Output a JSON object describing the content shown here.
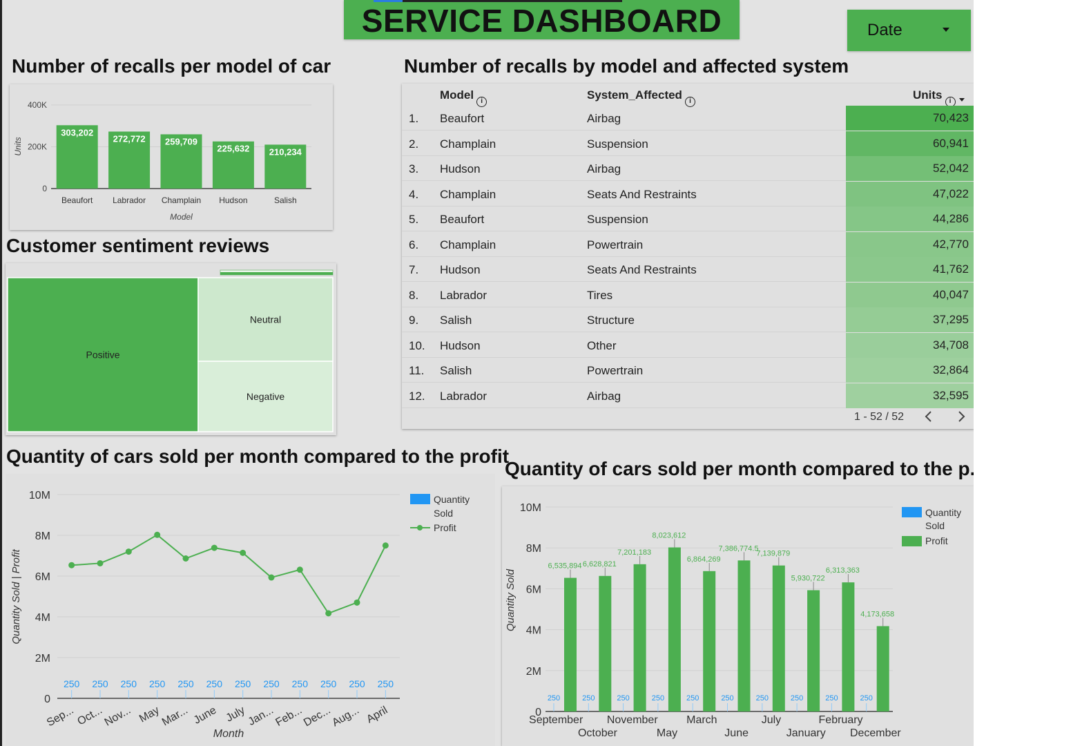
{
  "header": {
    "title": "SERVICE DASHBOARD",
    "date_filter_label": "Date"
  },
  "recalls_per_model": {
    "section_title": "Number of recalls per model of car",
    "chart_data": {
      "type": "bar",
      "categories": [
        "Beaufort",
        "Labrador",
        "Champlain",
        "Hudson",
        "Salish"
      ],
      "values": [
        303202,
        272772,
        259709,
        225632,
        210234
      ],
      "value_labels": [
        "303,202",
        "272,772",
        "259,709",
        "225,632",
        "210,234"
      ],
      "yticks": [
        "400K",
        "200K",
        "0"
      ],
      "ylim": [
        0,
        400000
      ],
      "xlabel": "Model",
      "ylabel": "Units",
      "color": "#4caf50"
    }
  },
  "sentiment": {
    "section_title": "Customer sentiment reviews",
    "chart_data": {
      "type": "treemap",
      "labels": [
        "Positive",
        "Neutral",
        "Negative"
      ],
      "colors": [
        "#4caf50",
        "#cde8cd",
        "#d9eed9"
      ]
    }
  },
  "recalls_table": {
    "section_title": "Number of recalls by model and affected system",
    "columns": [
      "Model",
      "System_Affected",
      "Units"
    ],
    "rows": [
      {
        "idx": "1.",
        "model": "Beaufort",
        "system": "Airbag",
        "units": "70,423",
        "value": 70423
      },
      {
        "idx": "2.",
        "model": "Champlain",
        "system": "Suspension",
        "units": "60,941",
        "value": 60941
      },
      {
        "idx": "3.",
        "model": "Hudson",
        "system": "Airbag",
        "units": "52,042",
        "value": 52042
      },
      {
        "idx": "4.",
        "model": "Champlain",
        "system": "Seats And Restraints",
        "units": "47,022",
        "value": 47022
      },
      {
        "idx": "5.",
        "model": "Beaufort",
        "system": "Suspension",
        "units": "44,286",
        "value": 44286
      },
      {
        "idx": "6.",
        "model": "Champlain",
        "system": "Powertrain",
        "units": "42,770",
        "value": 42770
      },
      {
        "idx": "7.",
        "model": "Hudson",
        "system": "Seats And Restraints",
        "units": "41,762",
        "value": 41762
      },
      {
        "idx": "8.",
        "model": "Labrador",
        "system": "Tires",
        "units": "40,047",
        "value": 40047
      },
      {
        "idx": "9.",
        "model": "Salish",
        "system": "Structure",
        "units": "37,295",
        "value": 37295
      },
      {
        "idx": "10.",
        "model": "Hudson",
        "system": "Other",
        "units": "34,708",
        "value": 34708
      },
      {
        "idx": "11.",
        "model": "Salish",
        "system": "Powertrain",
        "units": "32,864",
        "value": 32864
      },
      {
        "idx": "12.",
        "model": "Labrador",
        "system": "Airbag",
        "units": "32,595",
        "value": 32595
      }
    ],
    "pagination": "1 - 52 / 52",
    "heat_color_max": "#4caf50",
    "heat_color_min": "#9fd09f"
  },
  "line_chart": {
    "section_title": "Quantity of cars sold per month compared to the profit",
    "chart_data": {
      "type": "line",
      "categories": [
        "Sep...",
        "Oct...",
        "Nov...",
        "May",
        "Mar...",
        "June",
        "July",
        "Jan...",
        "Feb...",
        "Dec...",
        "Aug...",
        "April"
      ],
      "series": [
        {
          "name": "Quantity Sold",
          "values": [
            250,
            250,
            250,
            250,
            250,
            250,
            250,
            250,
            250,
            250,
            250,
            250
          ],
          "color": "#2196f3"
        },
        {
          "name": "Profit",
          "values": [
            6535894,
            6628821,
            7201183,
            8023612,
            6864269,
            7386774.5,
            7139879,
            5930722,
            6313363,
            4173658,
            4700000,
            7500000
          ],
          "color": "#4caf50"
        }
      ],
      "quantity_labels": [
        "250",
        "250",
        "250",
        "250",
        "250",
        "250",
        "250",
        "250",
        "250",
        "250",
        "250",
        "250"
      ],
      "yticks": [
        "10M",
        "8M",
        "6M",
        "4M",
        "2M",
        "0"
      ],
      "ylim": [
        0,
        10000000
      ],
      "xlabel": "Month",
      "ylabel": "Quantity Sold | Profit",
      "legend": [
        "Quantity Sold",
        "Profit"
      ]
    }
  },
  "bar_chart": {
    "section_title": "Quantity of cars sold per month compared to the p...",
    "chart_data": {
      "type": "bar",
      "categories": [
        "September",
        "October",
        "November",
        "May",
        "March",
        "June",
        "July",
        "January",
        "February",
        "December"
      ],
      "series": [
        {
          "name": "Quantity Sold",
          "values": [
            250,
            250,
            250,
            250,
            250,
            250,
            250,
            250,
            250,
            250
          ],
          "color": "#2196f3"
        },
        {
          "name": "Profit",
          "values": [
            6535894,
            6628821,
            7201183,
            8023612,
            6864269,
            7386774.5,
            7139879,
            5930722,
            6313363,
            4173658
          ],
          "color": "#4caf50"
        }
      ],
      "profit_labels": [
        "6,535,894",
        "6,628,821",
        "7,201,183",
        "8,023,612",
        "6,864,269",
        "7,386,774.5",
        "7,139,879",
        "5,930,722",
        "6,313,363",
        "4,173,658"
      ],
      "quantity_labels": [
        "250",
        "250",
        "250",
        "250",
        "250",
        "250",
        "250",
        "250",
        "250",
        "250"
      ],
      "yticks": [
        "10M",
        "8M",
        "6M",
        "4M",
        "2M",
        "0"
      ],
      "ylim": [
        0,
        10000000
      ],
      "ylabel": "Quantity Sold",
      "legend": [
        "Quantity Sold",
        "Profit"
      ]
    }
  }
}
